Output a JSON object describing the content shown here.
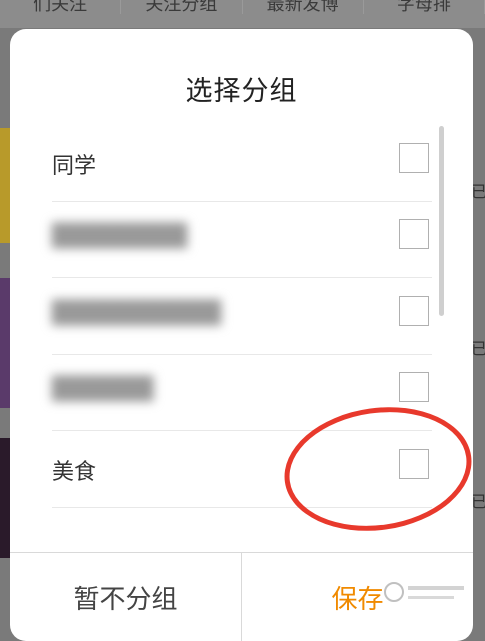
{
  "background": {
    "tabs": [
      "们关注",
      "关注分组",
      "最新发博",
      "字母排"
    ],
    "right_mark": "已"
  },
  "dialog": {
    "title": "选择分组",
    "groups": [
      {
        "label": "同学",
        "blurred": false,
        "checked": false
      },
      {
        "label": "",
        "blurred": true,
        "checked": false
      },
      {
        "label": "",
        "blurred": true,
        "checked": false
      },
      {
        "label": "",
        "blurred": true,
        "checked": false
      },
      {
        "label": "美食",
        "blurred": false,
        "checked": false
      }
    ],
    "cancel_label": "暂不分组",
    "save_label": "保存"
  },
  "colors": {
    "save_accent": "#f08a00",
    "annotation_circle": "#e8392c"
  }
}
